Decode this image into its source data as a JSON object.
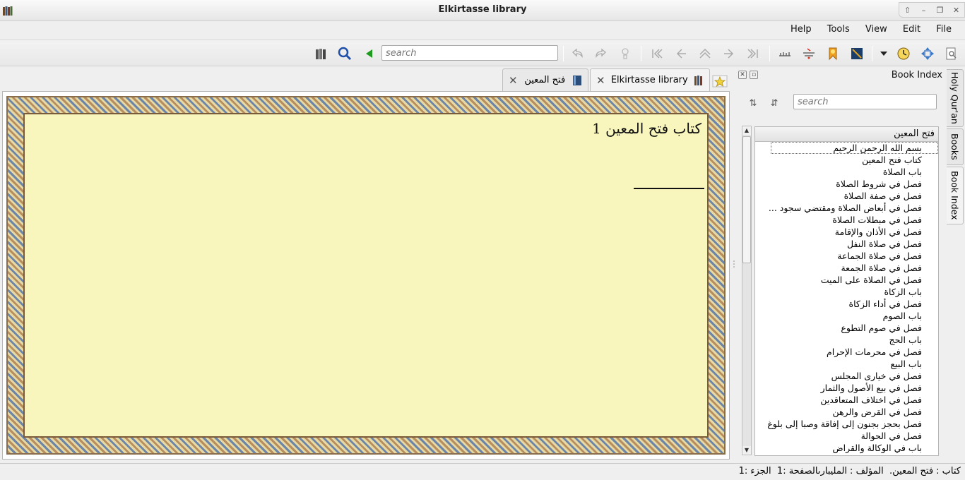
{
  "window": {
    "title": "Elkirtasse library"
  },
  "menu": [
    "File",
    "Edit",
    "View",
    "Tools",
    "Help"
  ],
  "toolbar": {
    "search_placeholder": "search"
  },
  "tabs": [
    {
      "label": "Elkirtasse library",
      "active": true
    },
    {
      "label": "فتح المعين",
      "active": false
    }
  ],
  "content": {
    "heading": "كتاب فتح المعين 1"
  },
  "dock": {
    "title": "Book Index",
    "search_placeholder": "search",
    "tree_header": "فتح المعين",
    "items": [
      "بسم الله الرحمن الرحيم",
      "كتاب فتح المعين",
      "باب الصلاة",
      "فصل في شروط الصلاة",
      "فصل في صفة الصلاة",
      "فصل في أبعاض الصلاة ومقتضي سجود ...",
      "فصل في مبطلات الصلاة",
      "فصل في الأذان والإقامة",
      "فصل في صلاة النفل",
      "فصل في صلاة الجماعة",
      "فصل في صلاة الجمعة",
      "فصل في الصلاة على الميت",
      "باب الزكاة",
      "فصل في أداء الزكاة",
      "باب الصوم",
      "فصل في صوم التطوع",
      "باب الحج",
      "فصل في محرمات الإحرام",
      "باب البيع",
      "فصل في خيارى المجلس",
      "فصل في بيع الأصول والثمار",
      "فصل في اختلاف المتعاقدين",
      "فصل في القرض والرهن",
      "فصل بحجز بجنون إلى إفاقة وصبا إلى بلوغ",
      "فصل في الحوالة",
      "باب في الوكالة والقراض"
    ]
  },
  "side_tabs": [
    "Holy Qur'an",
    "Books",
    "Book Index"
  ],
  "status": "كتاب : فتح المعين.  المؤلف : المليبارىالصفحة :1  الجزء :1"
}
